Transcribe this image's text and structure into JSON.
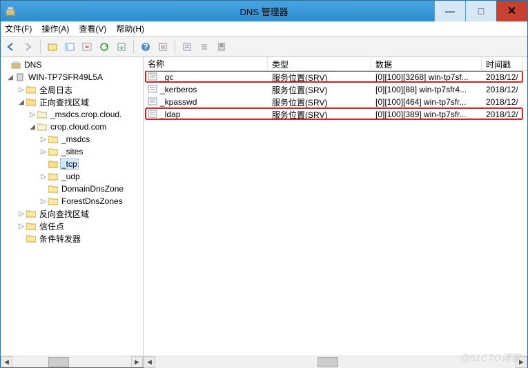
{
  "window": {
    "title": "DNS 管理器"
  },
  "menu": {
    "file": "文件(F)",
    "action": "操作(A)",
    "view": "查看(V)",
    "help": "帮助(H)"
  },
  "tree": {
    "root": "DNS",
    "server": "WIN-TP7SFR49L5A",
    "global_log": "全局日志",
    "fwd_zone": "正向查找区域",
    "msdcs_zone": "_msdcs.crop.cloud.",
    "crop_zone": "crop.cloud.com",
    "sub_msdcs": "_msdcs",
    "sub_sites": "_sites",
    "sub_tcp": "_tcp",
    "sub_udp": "_udp",
    "sub_ddz": "DomainDnsZone",
    "sub_fdz": "ForestDnsZones",
    "rev_zone": "反向查找区域",
    "trust": "信任点",
    "cond_fwd": "条件转发器"
  },
  "columns": {
    "name": "名称",
    "type": "类型",
    "data": "数据",
    "timestamp": "时间戳"
  },
  "rows": [
    {
      "name": "_gc",
      "type": "服务位置(SRV)",
      "data": "[0][100][3268] win-tp7sf...",
      "time": "2018/12/"
    },
    {
      "name": "_kerberos",
      "type": "服务位置(SRV)",
      "data": "[0][100][88] win-tp7sfr4...",
      "time": "2018/12/"
    },
    {
      "name": "_kpasswd",
      "type": "服务位置(SRV)",
      "data": "[0][100][464] win-tp7sfr...",
      "time": "2018/12/"
    },
    {
      "name": "_ldap",
      "type": "服务位置(SRV)",
      "data": "[0][100][389] win-tp7sfr...",
      "time": "2018/12/"
    }
  ],
  "watermark": "@51CTO博客"
}
